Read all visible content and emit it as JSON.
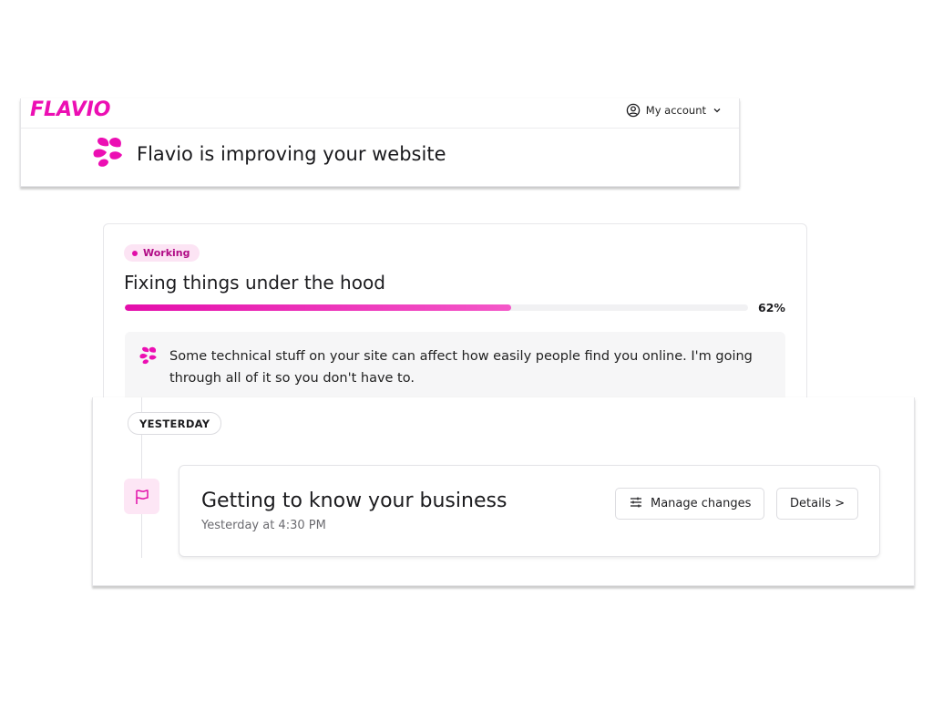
{
  "header": {
    "logo_text": "FLAVIO",
    "account_label": "My account",
    "icons": {
      "account": "user-circle-icon",
      "chevron": "chevron-down-icon"
    }
  },
  "hero": {
    "title": "Flavio is improving your website",
    "icon": "flavio-flower-icon"
  },
  "status": {
    "badge": "Working",
    "title": "Fixing things under the hood",
    "progress_percent": 62,
    "progress_label": "62%",
    "note": "Some technical stuff on your site can affect how easily people find you online. I'm going through all of it so you don't have to."
  },
  "timeline": {
    "day_label": "YESTERDAY",
    "events": [
      {
        "title": "Getting to know your business",
        "time": "Yesterday at 4:30 PM",
        "icon": "flag-icon",
        "manage_label": "Manage changes",
        "manage_icon": "sliders-icon",
        "details_label": "Details >"
      }
    ]
  },
  "colors": {
    "brand": "#ec0fb3",
    "badge_bg": "#fce4f4",
    "badge_text": "#b10c86",
    "progress_start": "#e40eab",
    "progress_end": "#f458c8"
  }
}
